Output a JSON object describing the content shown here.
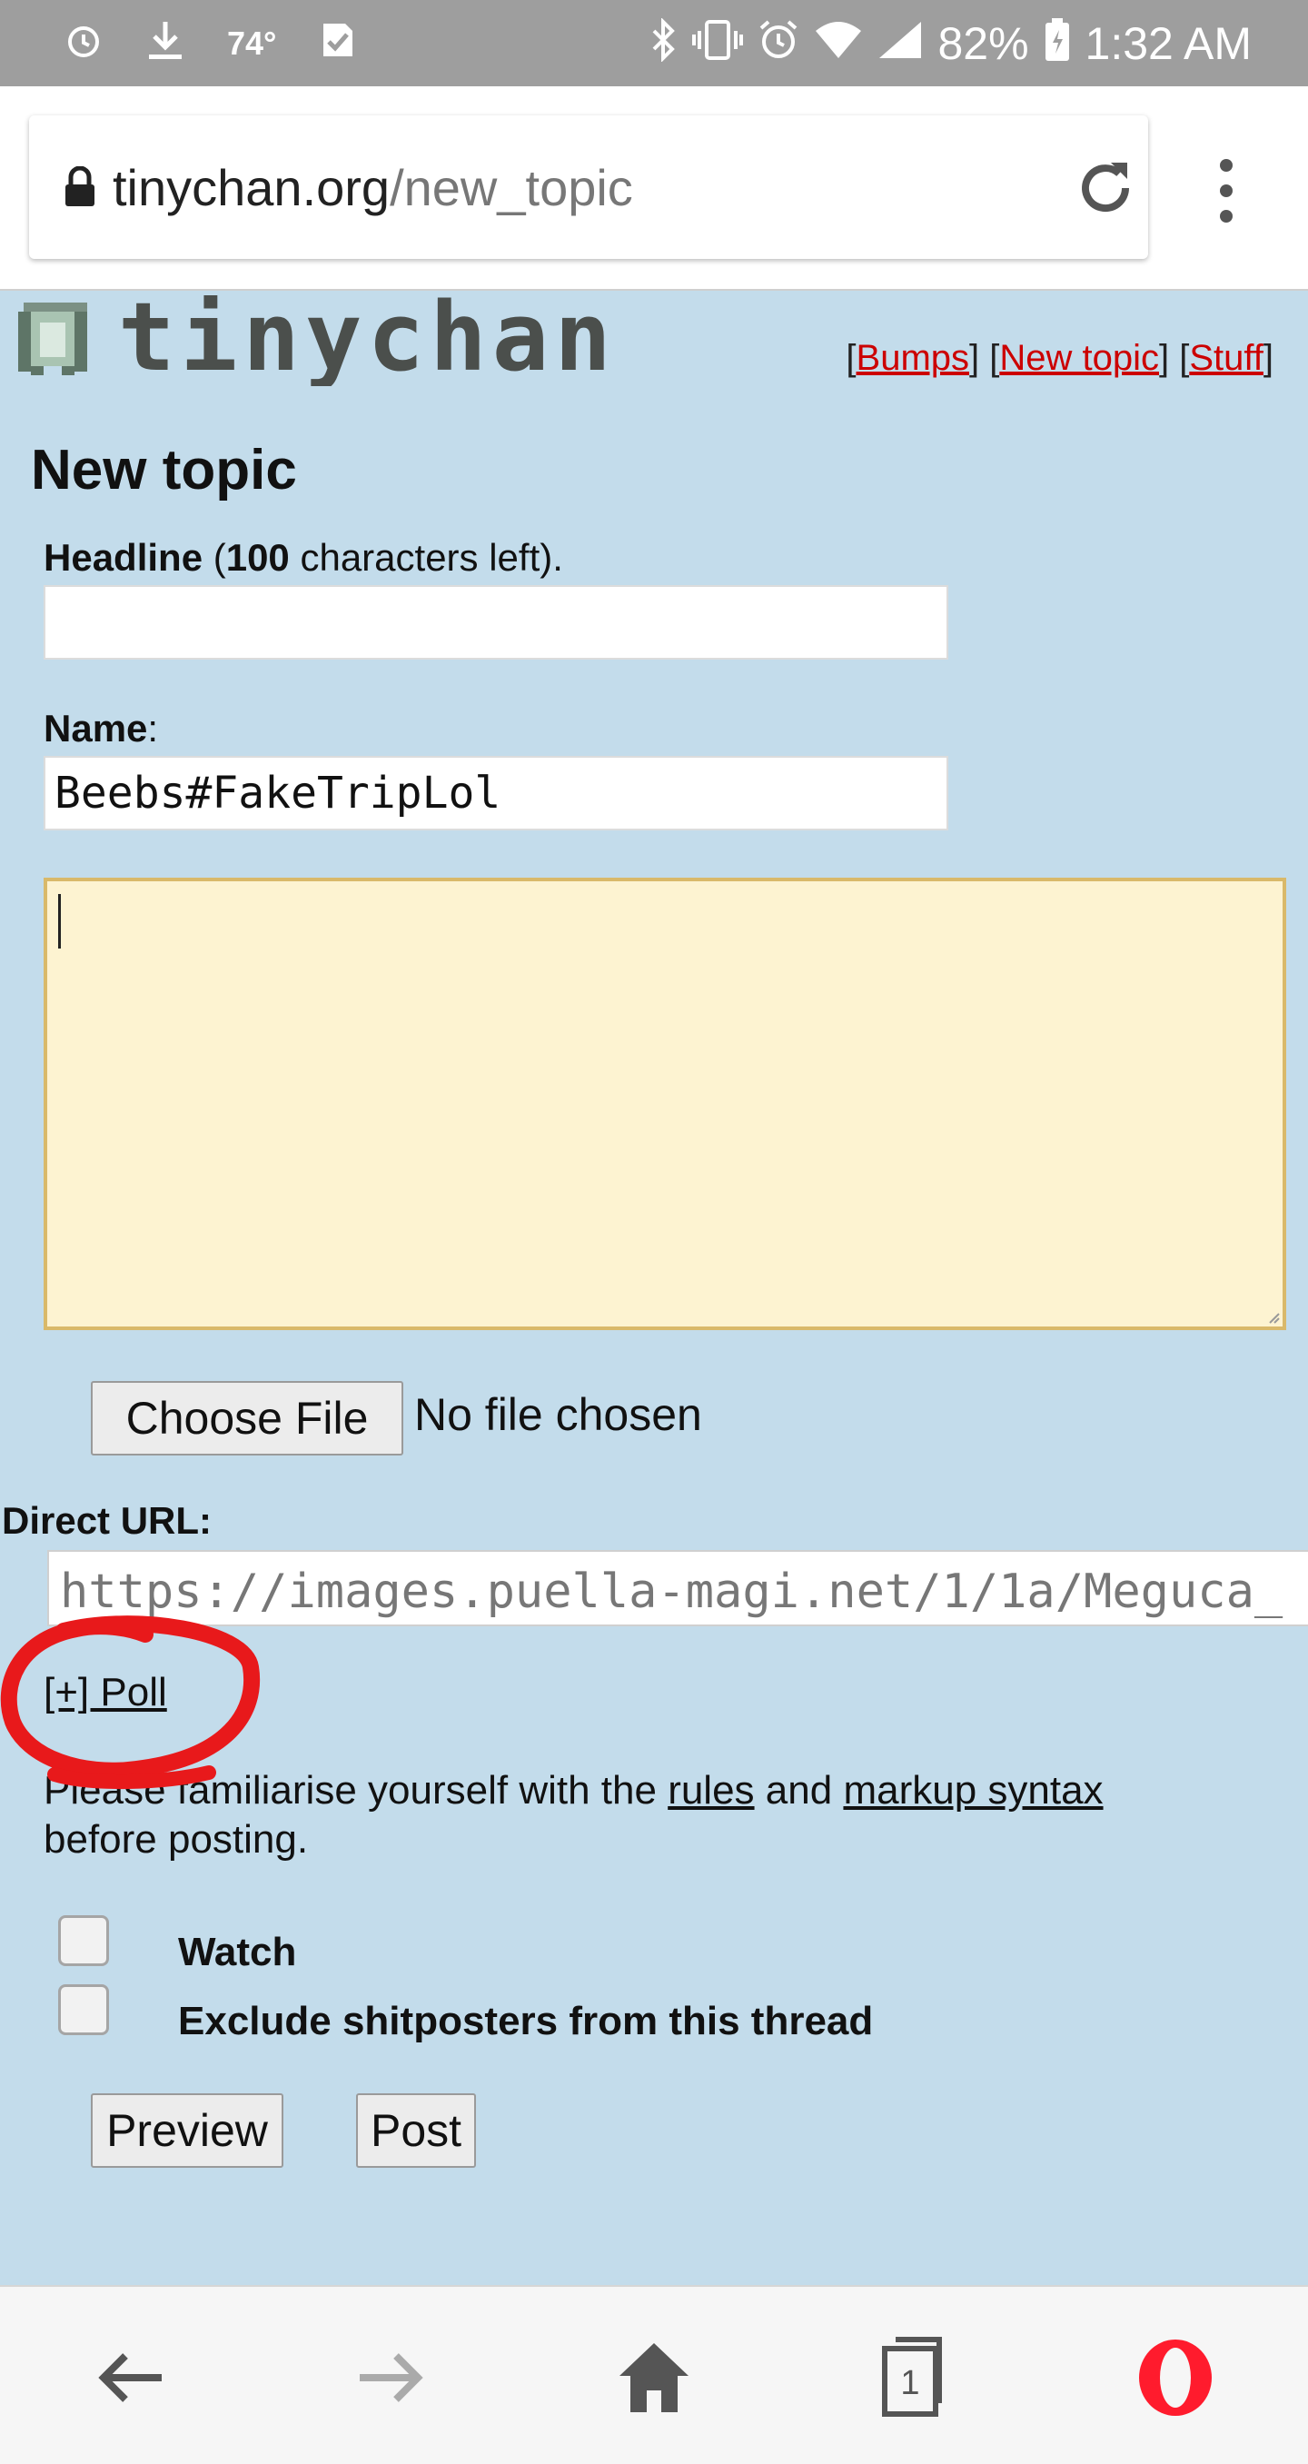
{
  "status_bar": {
    "temperature": "74°",
    "battery": "82%",
    "time": "1:32 AM",
    "icons": [
      "alarm-icon",
      "download-icon",
      "temperature-icon",
      "checklist-icon",
      "bluetooth-icon",
      "vibrate-icon",
      "alarm-icon",
      "wifi-icon",
      "signal-icon",
      "battery-icon"
    ]
  },
  "browser": {
    "url_host": "tinychan.org",
    "url_path": "/new_topic"
  },
  "header": {
    "logo_text": "tinychan",
    "nav": [
      {
        "label": "Bumps"
      },
      {
        "label": "New topic"
      },
      {
        "label": "Stuff"
      }
    ]
  },
  "form": {
    "title": "New topic",
    "headline_label": "Headline",
    "headline_chars_left": "100",
    "headline_suffix": "characters left).",
    "headline_value": "",
    "name_label": "Name",
    "name_value": "Beebs#FakeTripLol",
    "body_value": "",
    "choose_file_label": "Choose File",
    "no_file_text": "No file chosen",
    "direct_url_label": "Direct URL:",
    "direct_url_value": "https://images.puella-magi.net/1/1a/Meguca_",
    "poll_link": "[+] Poll",
    "rules_text_1": "Please familiarise yourself with the",
    "rules_link": "rules",
    "rules_text_2": "and",
    "markup_link": "markup syntax",
    "rules_text_3": "before posting.",
    "watch_label": "Watch",
    "exclude_label": "Exclude shitposters from this thread",
    "preview_label": "Preview",
    "post_label": "Post"
  },
  "colors": {
    "page_bg": "#c3dceb",
    "link_red": "#cc0000",
    "textarea_bg": "#fdf3d1",
    "annotation_red": "#e8191b",
    "opera_red": "#ff1b2d"
  }
}
